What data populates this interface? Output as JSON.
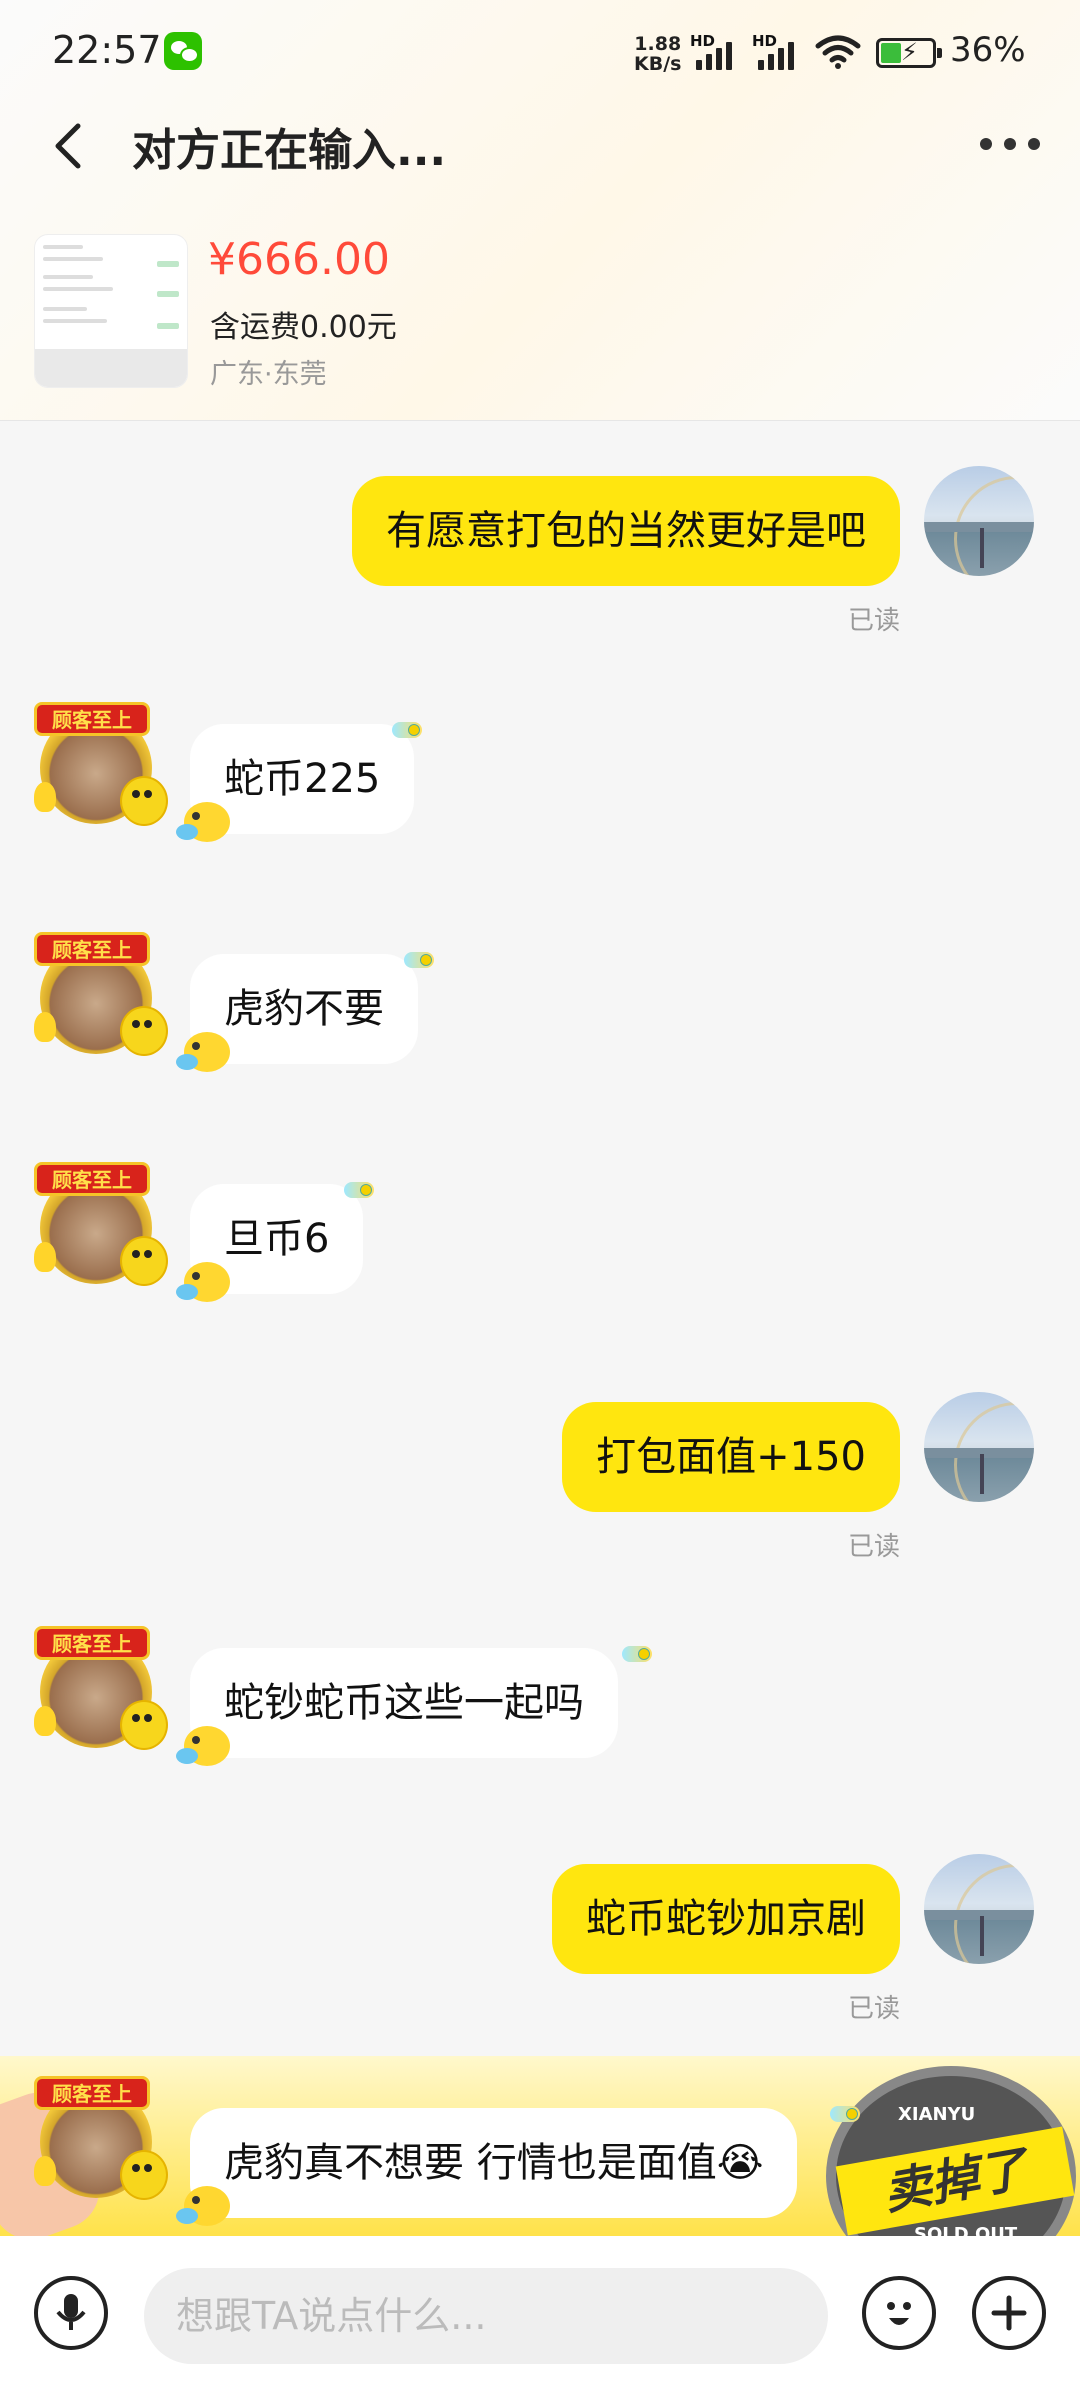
{
  "status_bar": {
    "time": "22:57",
    "net_speed_top": "1.88",
    "net_speed_bottom": "KB/s",
    "signal_label_1": "HD",
    "signal_label_2": "HD",
    "battery_percent": "36%",
    "notification_icon": "wechat-icon"
  },
  "nav": {
    "title": "对方正在输入..."
  },
  "product": {
    "price": "¥666.00",
    "shipping": "含运费0.00元",
    "location": "广东·东莞"
  },
  "messages": [
    {
      "side": "me",
      "text": "有愿意打包的当然更好是吧",
      "status": "已读"
    },
    {
      "side": "other",
      "text": "蛇币225"
    },
    {
      "side": "other",
      "text": "虎豹不要"
    },
    {
      "side": "other",
      "text": "旦币6"
    },
    {
      "side": "me",
      "text": "打包面值+150",
      "status": "已读"
    },
    {
      "side": "other",
      "text": "蛇钞蛇币这些一起吗"
    },
    {
      "side": "me",
      "text": "蛇币蛇钞加京剧",
      "status": "已读"
    },
    {
      "side": "other",
      "text": "虎豹真不想要 行情也是面值😭"
    }
  ],
  "seller_avatar": {
    "banner": "顾客至上"
  },
  "promo": {
    "badge_top": "XIANYU",
    "badge_main": "卖掉了",
    "badge_bottom": "SOLD OUT"
  },
  "input": {
    "placeholder": "想跟TA说点什么..."
  },
  "colors": {
    "my_bubble": "#ffe60f",
    "price": "#ff4a39",
    "read_status": "#999999"
  }
}
